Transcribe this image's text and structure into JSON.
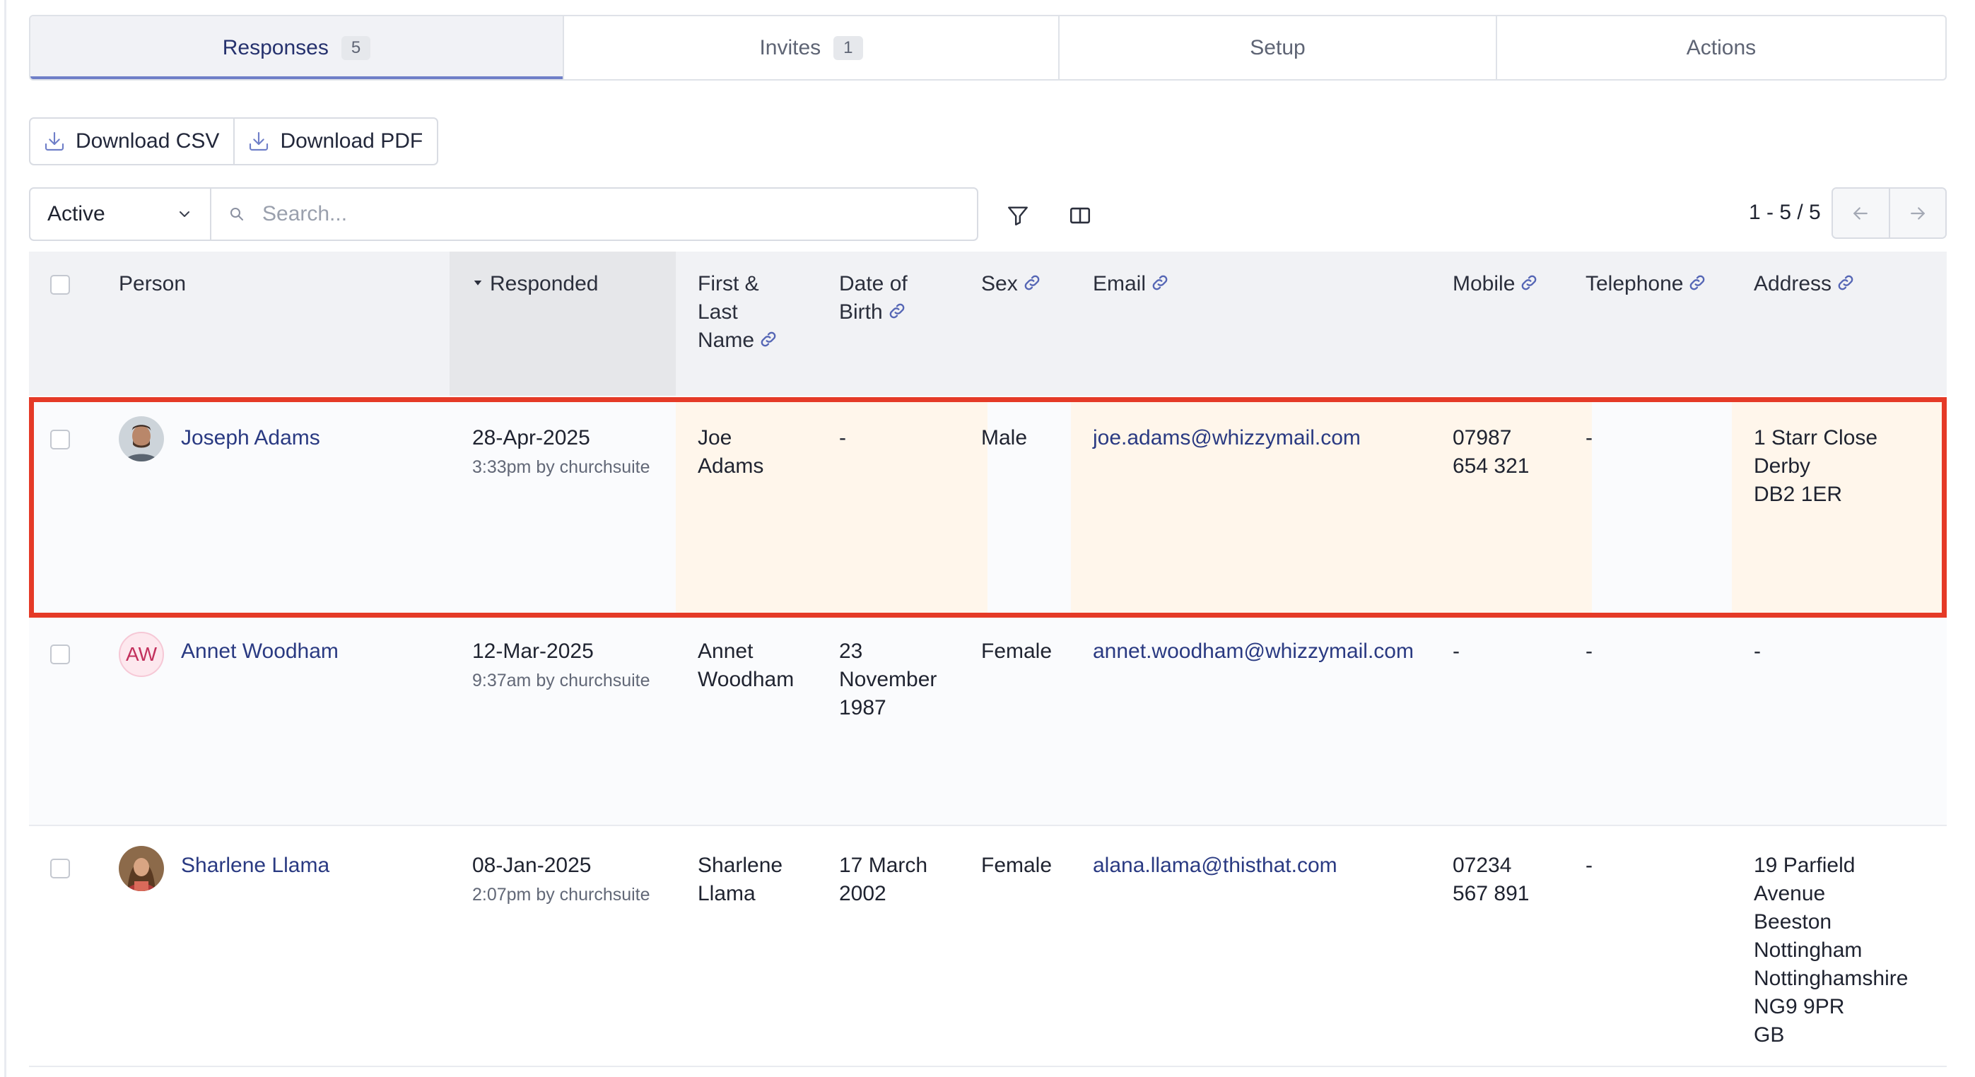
{
  "tabs": [
    {
      "label": "Responses",
      "count": "5"
    },
    {
      "label": "Invites",
      "count": "1"
    },
    {
      "label": "Setup"
    },
    {
      "label": "Actions"
    }
  ],
  "toolbar": {
    "download_csv": "Download CSV",
    "download_pdf": "Download PDF"
  },
  "filters": {
    "status_selected": "Active",
    "search_placeholder": "Search..."
  },
  "pagination": {
    "range": "1 - 5 / 5"
  },
  "columns": {
    "person": "Person",
    "responded": "Responded",
    "first_last_name": [
      "First &",
      "Last",
      "Name"
    ],
    "dob": [
      "Date of",
      "Birth"
    ],
    "sex": "Sex",
    "email": "Email",
    "mobile": "Mobile",
    "telephone": "Telephone",
    "address": "Address"
  },
  "rows": [
    {
      "name": "Joseph Adams",
      "avatar": "photo",
      "responded_date": "28-Apr-2025",
      "responded_by": "3:33pm by churchsuite",
      "first_last": [
        "Joe",
        "Adams"
      ],
      "dob": [
        "-"
      ],
      "sex": "Male",
      "email": "joe.adams@whizzymail.com",
      "mobile": [
        "07987",
        "654 321"
      ],
      "telephone": "-",
      "address": [
        "1 Starr Close",
        "Derby",
        "DB2 1ER"
      ]
    },
    {
      "name": "Annet Woodham",
      "avatar": "initials",
      "initials": "AW",
      "responded_date": "12-Mar-2025",
      "responded_by": "9:37am by churchsuite",
      "first_last": [
        "Annet",
        "Woodham"
      ],
      "dob": [
        "23",
        "November",
        "1987"
      ],
      "sex": "Female",
      "email": "annet.woodham@whizzymail.com",
      "mobile": [
        "-"
      ],
      "telephone": "-",
      "address": [
        "-"
      ]
    },
    {
      "name": "Sharlene Llama",
      "avatar": "photo",
      "responded_date": "08-Jan-2025",
      "responded_by": "2:07pm by churchsuite",
      "first_last": [
        "Sharlene",
        "Llama"
      ],
      "dob": [
        "17 March",
        "2002"
      ],
      "sex": "Female",
      "email": "alana.llama@thisthat.com",
      "mobile": [
        "07234",
        "567 891"
      ],
      "telephone": "-",
      "address": [
        "19 Parfield",
        "Avenue",
        "Beeston",
        "Nottingham",
        "Nottinghamshire",
        "NG9 9PR",
        "GB"
      ]
    }
  ],
  "colors": {
    "accent": "#6f7fc8",
    "link": "#2a3a82",
    "highlight_border": "#e53a27",
    "highlight_fill": "#fff6eb"
  }
}
